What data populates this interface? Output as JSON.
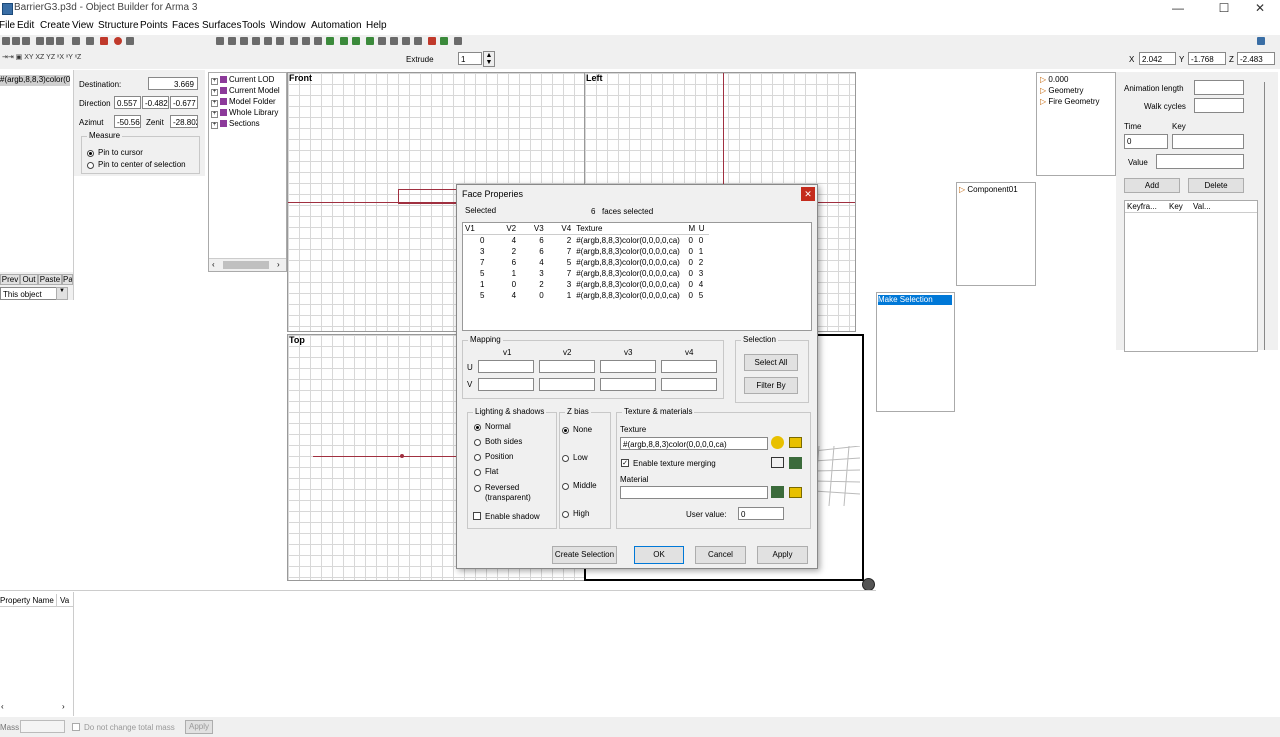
{
  "window": {
    "title": "BarrierG3.p3d - Object Builder for Arma 3",
    "minimize": "—",
    "maximize": "☐",
    "close": "✕"
  },
  "menu": [
    "File",
    "Edit",
    "Create",
    "View",
    "Structure",
    "Points",
    "Faces",
    "Surfaces",
    "Tools",
    "Window",
    "Automation",
    "Help"
  ],
  "toolbar2": {
    "extrude_label": "Extrude",
    "extrude_value": "1"
  },
  "coords": {
    "x_label": "X",
    "x_value": "2.042",
    "y_label": "Y",
    "y_value": "-1.768",
    "z_label": "Z",
    "z_value": "-2.483"
  },
  "left_panel": {
    "selected_item": "#(argb,8,8,3)color(0",
    "buttons": [
      "Prev",
      "Out",
      "Paste",
      "Pa"
    ],
    "scope_select": "This object"
  },
  "measure": {
    "destination_label": "Destination:",
    "destination_value": "3.669",
    "direction_label": "Direction",
    "direction_values": [
      "0.557",
      "-0.482",
      "-0.677"
    ],
    "azimut_label": "Azimut",
    "azimut_value": "-50.564",
    "zenit_label": "Zenit",
    "zenit_value": "-28.802",
    "group_title": "Measure",
    "option_pin_cursor": "Pin to cursor",
    "option_pin_center": "Pin to center of selection"
  },
  "tree": {
    "items": [
      "Current LOD",
      "Current Model",
      "Model Folder",
      "Whole Library",
      "Sections"
    ]
  },
  "viewports": {
    "front": "Front",
    "left": "Left",
    "top": "Top"
  },
  "lods": {
    "items": [
      "0.000",
      "Geometry",
      "Fire Geometry"
    ]
  },
  "components": {
    "items": [
      "Component01"
    ]
  },
  "named_sel": {
    "selected": "Make Selection"
  },
  "animation": {
    "length_label": "Animation length",
    "walk_label": "Walk cycles",
    "time_label": "Time",
    "key_label": "Key",
    "time_value": "0",
    "value_label": "Value",
    "add_button": "Add",
    "delete_button": "Delete",
    "columns": [
      "Keyfra...",
      "Key",
      "Val..."
    ]
  },
  "properties": {
    "columns": [
      "Property Name",
      "Va"
    ]
  },
  "mass_bar": {
    "mass_label": "Mass",
    "dont_change_label": "Do not change total mass",
    "apply_button": "Apply"
  },
  "dialog": {
    "title": "Face Properies",
    "selected_label": "Selected",
    "selected_count": "6",
    "selected_suffix": "faces selected",
    "table": {
      "columns": [
        "V1",
        "V2",
        "V3",
        "V4",
        "Texture",
        "M",
        "U"
      ],
      "rows": [
        [
          "0",
          "4",
          "6",
          "2",
          "#(argb,8,8,3)color(0,0,0,0,ca)",
          "0",
          "0"
        ],
        [
          "3",
          "2",
          "6",
          "7",
          "#(argb,8,8,3)color(0,0,0,0,ca)",
          "0",
          "1"
        ],
        [
          "7",
          "6",
          "4",
          "5",
          "#(argb,8,8,3)color(0,0,0,0,ca)",
          "0",
          "2"
        ],
        [
          "5",
          "1",
          "3",
          "7",
          "#(argb,8,8,3)color(0,0,0,0,ca)",
          "0",
          "3"
        ],
        [
          "1",
          "0",
          "2",
          "3",
          "#(argb,8,8,3)color(0,0,0,0,ca)",
          "0",
          "4"
        ],
        [
          "5",
          "4",
          "0",
          "1",
          "#(argb,8,8,3)color(0,0,0,0,ca)",
          "0",
          "5"
        ]
      ]
    },
    "mapping": {
      "title": "Mapping",
      "cols": [
        "v1",
        "v2",
        "v3",
        "v4"
      ],
      "u": "U",
      "v": "V"
    },
    "selection": {
      "title": "Selection",
      "select_all": "Select All",
      "filter_by": "Filter By"
    },
    "lighting": {
      "title": "Lighting & shadows",
      "options": [
        "Normal",
        "Both sides",
        "Position",
        "Flat",
        "Reversed"
      ],
      "reversed_sub": "(transparent)",
      "enable_shadow": "Enable shadow"
    },
    "zbias": {
      "title": "Z bias",
      "options": [
        "None",
        "Low",
        "Middle",
        "High"
      ]
    },
    "texmat": {
      "title": "Texture & materials",
      "texture_label": "Texture",
      "texture_value": "#(argb,8,8,3)color(0,0,0,0,ca)",
      "merging": "Enable texture merging",
      "material_label": "Material",
      "user_value_label": "User value:",
      "user_value": "0"
    },
    "buttons": {
      "create_selection": "Create Selection",
      "ok": "OK",
      "cancel": "Cancel",
      "apply": "Apply"
    }
  }
}
